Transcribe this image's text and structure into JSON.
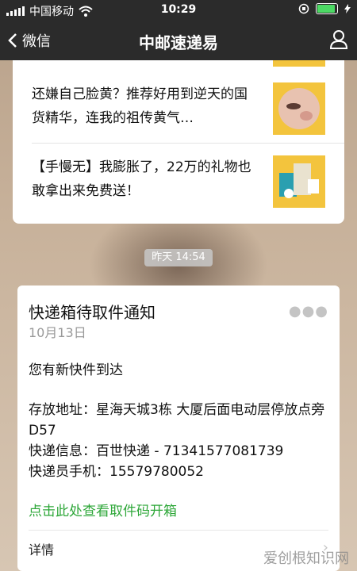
{
  "status_bar": {
    "carrier": "中国移动",
    "time": "10:29"
  },
  "nav": {
    "back_label": "微信",
    "title": "中邮速递易"
  },
  "articles": [
    {
      "text": "还嫌自己脸黄？推荐好用到逆天的国货精华，连我的祖传黄气…"
    },
    {
      "text": "【手慢无】我膨胀了，22万的礼物也敢拿出来免费送！"
    }
  ],
  "time_label": "昨天 14:54",
  "notification": {
    "title": "快递箱待取件通知",
    "date": "10月13日",
    "greeting": "您有新快件到达",
    "address_line": "存放地址：星海天城3栋 大厦后面电动层停放点旁D57",
    "courier_info": "快递信息：百世快递 - 71341577081739",
    "courier_phone": "快递员手机：15579780052",
    "action_link": "点击此处查看取件码开箱",
    "detail_label": "详情"
  },
  "watermark": "爱创根知识网",
  "colors": {
    "nav_bg": "#2b2b2b",
    "link_green": "#2ea739",
    "thumb_yellow": "#f3c43d",
    "battery_green": "#4cd964"
  }
}
